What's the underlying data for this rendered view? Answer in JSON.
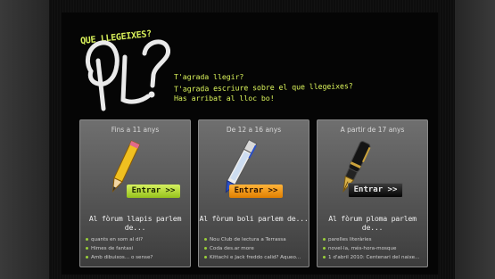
{
  "logo": {
    "tag": "QUE LLEGEIXES?",
    "intro_lines": [
      "T'agrada llegir?",
      "T'agrada escriure sobre el que llegeixes?",
      "Has arribat al lloc bo!"
    ]
  },
  "cards": [
    {
      "header": "Fins a 11 anys",
      "button": "Entrar >>",
      "forum": "Al fòrum llapis parlem de...",
      "topics": [
        "quants en som al di?",
        "Himes de fantasi",
        "Amb dibuixos... o sense?"
      ]
    },
    {
      "header": "De 12 a 16 anys",
      "button": "Entrar >>",
      "forum": "Al fòrum boli parlem de...",
      "topics": [
        "Nou Club de lectura a Terrassa",
        "Coda des.ar more",
        "Kittachi e Jack freddo calid? Aqueo..."
      ]
    },
    {
      "header": "A partir de 17 anys",
      "button": "Entrar >>",
      "forum": "Al fòrum ploma parlem de...",
      "topics": [
        "parelles literàries",
        "novel·la, més-hora-mosque",
        "1 d'abril 2010: Centenari del naixe..."
      ]
    }
  ],
  "colors": {
    "accent": "#d8f05a",
    "btn_green": "#b8dc3c",
    "btn_orange": "#f39a12",
    "btn_black": "#1a1a1a"
  }
}
